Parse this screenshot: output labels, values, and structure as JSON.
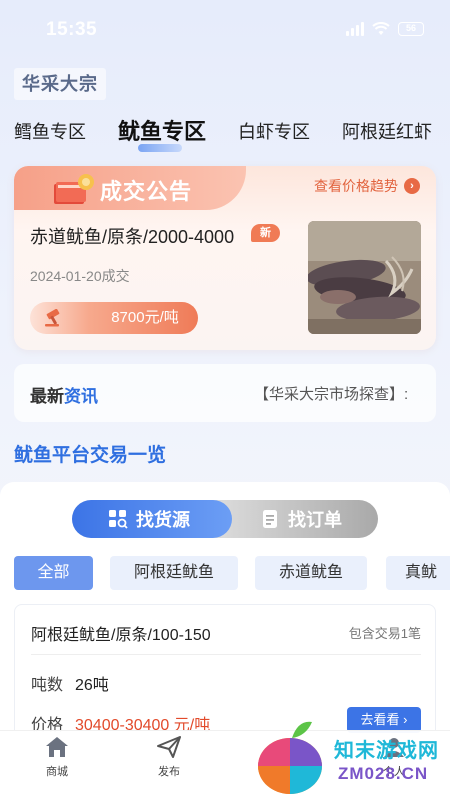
{
  "status_bar": {
    "time": "15:35",
    "battery": "56"
  },
  "brand": "华采大宗",
  "category_tabs": [
    {
      "label": "鳕鱼专区"
    },
    {
      "label": "鱿鱼专区"
    },
    {
      "label": "白虾专区"
    },
    {
      "label": "阿根廷红虾"
    }
  ],
  "active_category_index": 1,
  "deal_announcement": {
    "title": "成交公告",
    "trend_link": "查看价格趋势",
    "product": "赤道鱿鱼/原条/2000-4000",
    "new_badge": "新",
    "date": "2024-01-20成交",
    "price": "8700元/吨"
  },
  "news": {
    "label_prefix": "最新",
    "label_highlight": "资讯",
    "headline": "【华采大宗市场探查】:"
  },
  "section_title": "鱿鱼平台交易一览",
  "toggle": {
    "supply_label": "找货源",
    "orders_label": "找订单",
    "active": "supply"
  },
  "filters": [
    {
      "label": "全部"
    },
    {
      "label": "阿根廷鱿鱼"
    },
    {
      "label": "赤道鱿鱼"
    },
    {
      "label": "真鱿"
    }
  ],
  "active_filter_index": 0,
  "order": {
    "title": "阿根廷鱿鱼/原条/100-150",
    "trade_count": "包含交易1笔",
    "qty_label": "吨数",
    "qty_value": "26吨",
    "price_label": "价格",
    "price_value": "30400-30400 元/吨",
    "button": "去看看"
  },
  "bottom_nav": [
    {
      "label": "商城",
      "icon": "home-icon"
    },
    {
      "label": "发布",
      "icon": "send-icon"
    },
    {
      "label": "个人",
      "icon": "user-icon"
    }
  ],
  "watermark": {
    "line1": "知末游戏网",
    "line2": "ZM028.CN"
  },
  "colors": {
    "accent_blue": "#3c74e6",
    "deal_orange": "#e86a45",
    "price_red": "#e24a2b"
  }
}
